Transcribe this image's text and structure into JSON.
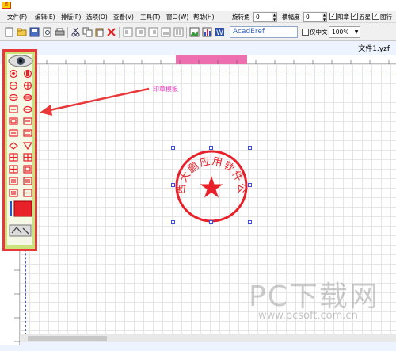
{
  "menubar": {
    "items": [
      "文件(F)",
      "编辑(E)",
      "排版(P)",
      "选项(O)",
      "查看(V)",
      "工具(T)",
      "窗口(W)",
      "帮助(H)"
    ]
  },
  "controls": {
    "rotation_label": "旋转角",
    "rotation_value": "0",
    "horizontal_label": "横幅度",
    "horizontal_value": "0",
    "checkbox_yangzhang": "阳章",
    "checkbox_wuxing": "五星",
    "checkbox_tuxing": "图行"
  },
  "toolbar": {
    "font_name": "AcadEref",
    "chinese_only_label": "仅中文",
    "zoom_value": "100%"
  },
  "document": {
    "tab_name": "文件1.yzf"
  },
  "annotation": {
    "label": "印章模板",
    "color": "#e040c0"
  },
  "stamp": {
    "text": "广西大鹏应用软件公司",
    "color": "#e8202a"
  },
  "watermark": {
    "brand": "PC下载网",
    "url": "www.pcsoft.com.cn"
  }
}
